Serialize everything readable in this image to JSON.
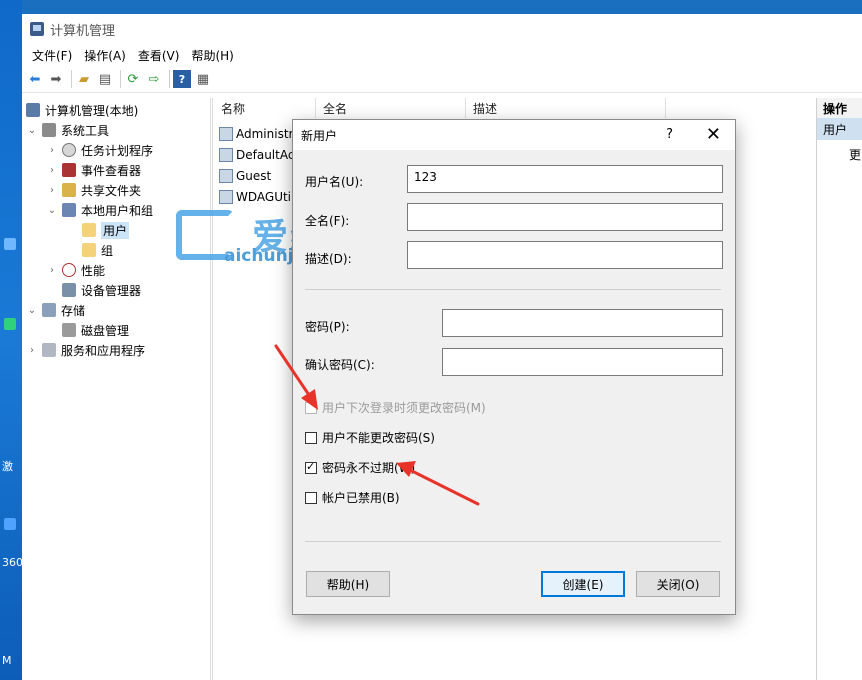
{
  "window": {
    "title": "计算机管理"
  },
  "menu": [
    "文件(F)",
    "操作(A)",
    "查看(V)",
    "帮助(H)"
  ],
  "tree": {
    "root": "计算机管理(本地)",
    "system_tools": "系统工具",
    "task_scheduler": "任务计划程序",
    "event_viewer": "事件查看器",
    "shared_folders": "共享文件夹",
    "local_users": "本地用户和组",
    "users": "用户",
    "groups": "组",
    "performance": "性能",
    "device_manager": "设备管理器",
    "storage": "存储",
    "disk_management": "磁盘管理",
    "services": "服务和应用程序"
  },
  "list": {
    "columns": [
      "名称",
      "全名",
      "描述"
    ],
    "rows": [
      "Administr",
      "DefaultAc",
      "Guest",
      "WDAGUti"
    ]
  },
  "actions": {
    "header": "操作",
    "sub": "用户",
    "more": "更"
  },
  "watermark": {
    "cn": "爱纯净",
    "en": "aichunjing.com"
  },
  "dialog": {
    "title": "新用户",
    "help_glyph": "?",
    "close_glyph": "✕",
    "username_label": "用户名(U):",
    "username_value": "123",
    "fullname_label": "全名(F):",
    "desc_label": "描述(D):",
    "password_label": "密码(P):",
    "confirm_label": "确认密码(C):",
    "cb_must_change": "用户下次登录时须更改密码(M)",
    "cb_cannot_change": "用户不能更改密码(S)",
    "cb_never_expires": "密码永不过期(W)",
    "cb_disabled": "帐户已禁用(B)",
    "btn_help": "帮助(H)",
    "btn_create": "创建(E)",
    "btn_close": "关闭(O)"
  },
  "desktop": {
    "labels": [
      "激",
      "360",
      "M"
    ]
  },
  "colors": {
    "accent": "#0078d7",
    "arrow": "#e8332b",
    "watermark": "#4aa5e6"
  },
  "icons": [
    "back-icon",
    "forward-icon",
    "folder-up-icon",
    "properties-icon",
    "refresh-icon",
    "export-icon",
    "help-icon",
    "console-icon"
  ]
}
